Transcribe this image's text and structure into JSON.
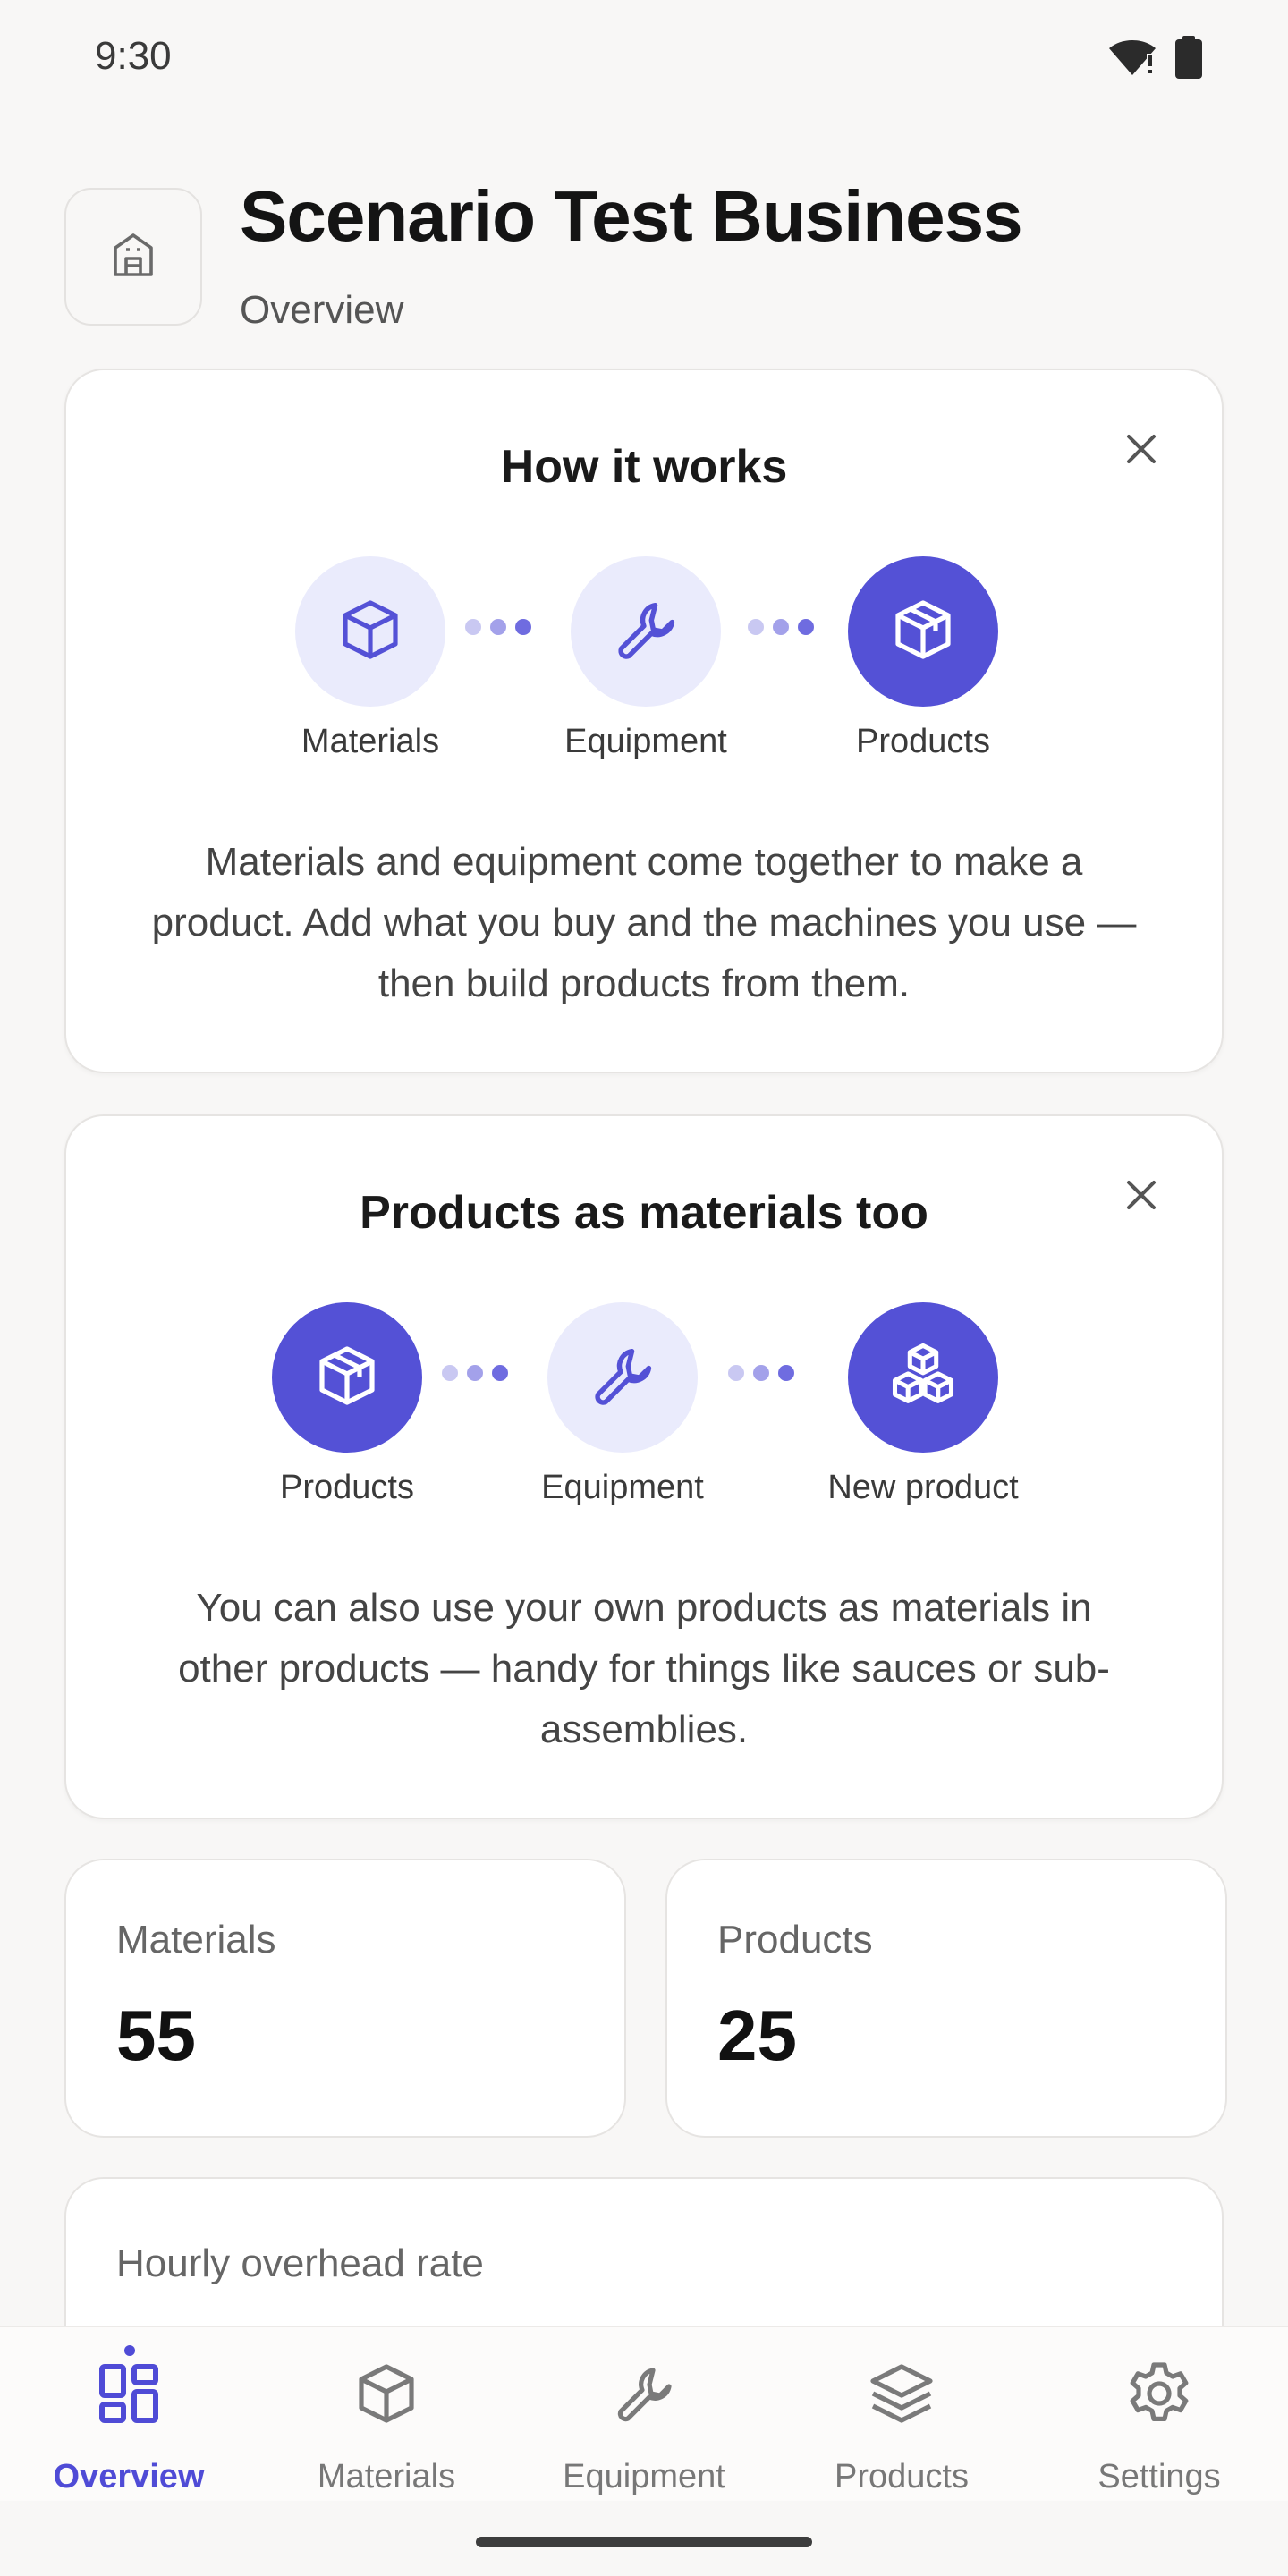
{
  "status_bar": {
    "time": "9:30"
  },
  "header": {
    "title": "Scenario Test Business",
    "subtitle": "Overview"
  },
  "how_it_works": {
    "title": "How it works",
    "steps": [
      {
        "label": "Materials",
        "icon": "cube-icon",
        "style": "light"
      },
      {
        "label": "Equipment",
        "icon": "wrench-icon",
        "style": "light"
      },
      {
        "label": "Products",
        "icon": "package-icon",
        "style": "dark"
      }
    ],
    "body": "Materials and equipment come together to make a product. Add what you buy and the machines you use — then build products from them."
  },
  "products_as_materials": {
    "title": "Products as materials too",
    "steps": [
      {
        "label": "Products",
        "icon": "package-icon",
        "style": "dark"
      },
      {
        "label": "Equipment",
        "icon": "wrench-icon",
        "style": "light"
      },
      {
        "label": "New product",
        "icon": "boxes-icon",
        "style": "dark"
      }
    ],
    "body": "You can also use your own products as materials in other products — handy for things like sauces or sub-assemblies."
  },
  "stats": [
    {
      "label": "Materials",
      "value": "55"
    },
    {
      "label": "Products",
      "value": "25"
    }
  ],
  "overhead": {
    "label": "Hourly overhead rate"
  },
  "nav": [
    {
      "label": "Overview",
      "icon": "dashboard-icon",
      "active": true
    },
    {
      "label": "Materials",
      "icon": "cube-icon",
      "active": false
    },
    {
      "label": "Equipment",
      "icon": "wrench-icon",
      "active": false
    },
    {
      "label": "Products",
      "icon": "layers-icon",
      "active": false
    },
    {
      "label": "Settings",
      "icon": "gear-icon",
      "active": false
    }
  ],
  "colors": {
    "accent": "#5451d6",
    "accent_light": "#eaebfc",
    "background": "#f8f7f6"
  }
}
